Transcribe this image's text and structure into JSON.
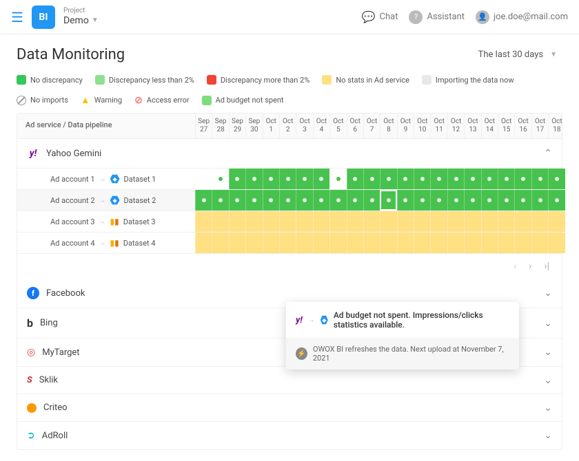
{
  "header": {
    "logo_text": "BI",
    "project_label": "Project",
    "project_name": "Demo",
    "chat": "Chat",
    "assistant": "Assistant",
    "user": "joe.doe@mail.com"
  },
  "page": {
    "title": "Data Monitoring",
    "range": "The last 30 days"
  },
  "legend": {
    "no_disc": "No discrepancy",
    "less2": "Discrepancy less than 2%",
    "more2": "Discrepancy more than 2%",
    "no_stats": "No stats in Ad service",
    "importing": "Importing the data now",
    "no_imports": "No imports",
    "warning": "Warning",
    "access_err": "Access error",
    "not_spent": "Ad budget not spent"
  },
  "grid": {
    "name_header": "Ad service / Data pipeline",
    "dates": [
      {
        "m": "Sep",
        "d": "27"
      },
      {
        "m": "Sep",
        "d": "28"
      },
      {
        "m": "Sep",
        "d": "29"
      },
      {
        "m": "Sep",
        "d": "30"
      },
      {
        "m": "Oct",
        "d": "1"
      },
      {
        "m": "Oct",
        "d": "2"
      },
      {
        "m": "Oct",
        "d": "3"
      },
      {
        "m": "Oct",
        "d": "4"
      },
      {
        "m": "Oct",
        "d": "5"
      },
      {
        "m": "Oct",
        "d": "6"
      },
      {
        "m": "Oct",
        "d": "7"
      },
      {
        "m": "Oct",
        "d": "8"
      },
      {
        "m": "Oct",
        "d": "9"
      },
      {
        "m": "Oct",
        "d": "10"
      },
      {
        "m": "Oct",
        "d": "11"
      },
      {
        "m": "Oct",
        "d": "12"
      },
      {
        "m": "Oct",
        "d": "13"
      },
      {
        "m": "Oct",
        "d": "14"
      },
      {
        "m": "Oct",
        "d": "15"
      },
      {
        "m": "Oct",
        "d": "16"
      },
      {
        "m": "Oct",
        "d": "17"
      },
      {
        "m": "Oct",
        "d": "18"
      }
    ]
  },
  "providers": {
    "yahoo": "Yahoo Gemini",
    "facebook": "Facebook",
    "bing": "Bing",
    "mytarget": "MyTarget",
    "sklik": "Sklik",
    "criteo": "Criteo",
    "adroll": "AdRoll"
  },
  "rows": {
    "r1a": "Ad account 1",
    "r1b": "Dataset 1",
    "r2a": "Ad account 2",
    "r2b": "Dataset 2",
    "r3a": "Ad account 3",
    "r3b": "Dataset 3",
    "r4a": "Ad account 4",
    "r4b": "Dataset 4"
  },
  "tooltip": {
    "main": "Ad budget not spent. Impressions/clicks statistics available.",
    "sub": "OWOX BI refreshes the data. Next upload at November 7, 2021"
  }
}
